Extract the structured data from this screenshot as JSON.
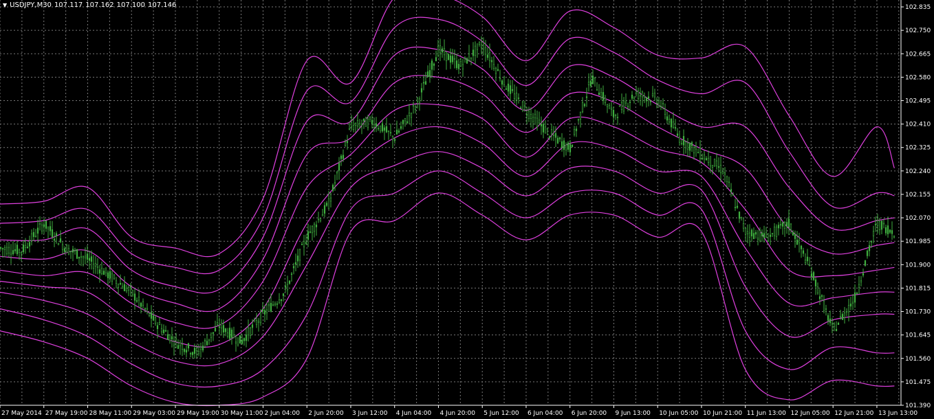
{
  "colors": {
    "background": "#000000",
    "grid": "#7a7a7a",
    "axis": "#ffffff",
    "candle": "#3fae3f",
    "bands": "#e040e0"
  },
  "header": {
    "collapse_icon": "triangle-down-icon",
    "symbol": "USDJPY,M30",
    "ohlc": [
      "107.117",
      "107.162",
      "107.100",
      "107.146"
    ]
  },
  "chart_data": {
    "type": "candlestick",
    "title": "USDJPY,M30",
    "grid": true,
    "price_axis": "right",
    "ylim": [
      101.39,
      102.86
    ],
    "y_ticks": [
      102.835,
      102.75,
      102.665,
      102.58,
      102.495,
      102.41,
      102.325,
      102.24,
      102.155,
      102.07,
      101.985,
      101.9,
      101.815,
      101.73,
      101.645,
      101.56,
      101.475,
      101.39
    ],
    "y_tick_labels": [
      "102.835",
      "102.750",
      "102.665",
      "102.580",
      "102.495",
      "102.410",
      "102.325",
      "102.240",
      "102.155",
      "102.070",
      "101.985",
      "101.900",
      "101.815",
      "101.730",
      "101.645",
      "101.560",
      "101.475",
      "101.390"
    ],
    "x_tick_labels": [
      "27 May 2014",
      "27 May 19:00",
      "28 May 11:00",
      "29 May 03:00",
      "29 May 19:00",
      "30 May 11:00",
      "2 Jun 04:00",
      "2 Jun 20:00",
      "3 Jun 12:00",
      "4 Jun 04:00",
      "4 Jun 20:00",
      "5 Jun 12:00",
      "6 Jun 04:00",
      "6 Jun 20:00",
      "9 Jun 13:00",
      "10 Jun 05:00",
      "10 Jun 21:00",
      "11 Jun 13:00",
      "12 Jun 05:00",
      "12 Jun 21:00",
      "13 Jun 13:00"
    ],
    "series": [
      {
        "kind": "price",
        "x": [
          0,
          0.5,
          1,
          1.5,
          2,
          2.5,
          3,
          3.5,
          4,
          4.5,
          5,
          5.5,
          6,
          6.5,
          7,
          7.5,
          8,
          8.5,
          9,
          9.5,
          10,
          10.5,
          11,
          11.5,
          12,
          12.5,
          13,
          13.5,
          14,
          14.5,
          15,
          15.5,
          16,
          16.5,
          17,
          17.5,
          18,
          18.5,
          19,
          19.5,
          20,
          20.4
        ],
        "values": [
          101.96,
          101.95,
          102.05,
          101.96,
          101.92,
          101.86,
          101.8,
          101.7,
          101.62,
          101.58,
          101.68,
          101.62,
          101.72,
          101.8,
          102.0,
          102.12,
          102.4,
          102.42,
          102.36,
          102.48,
          102.68,
          102.62,
          102.7,
          102.56,
          102.46,
          102.38,
          102.32,
          102.58,
          102.44,
          102.52,
          102.5,
          102.36,
          102.3,
          102.24,
          102.02,
          102.0,
          102.05,
          101.88,
          101.66,
          101.78,
          102.05,
          102.02
        ]
      },
      {
        "kind": "band",
        "x": [
          0,
          1,
          2,
          3,
          4,
          5,
          6,
          7,
          8,
          9,
          10,
          11,
          12,
          13,
          14,
          15,
          16,
          17,
          18,
          19,
          20,
          20.4
        ],
        "values": [
          102.12,
          102.13,
          102.18,
          102.0,
          101.96,
          101.94,
          102.14,
          102.64,
          102.56,
          102.87,
          102.88,
          102.8,
          102.64,
          102.82,
          102.76,
          102.66,
          102.65,
          102.69,
          102.44,
          102.22,
          102.4,
          102.25
        ]
      },
      {
        "kind": "band",
        "x": [
          0,
          1,
          2,
          3,
          4,
          5,
          6,
          7,
          8,
          9,
          10,
          11,
          12,
          13,
          14,
          15,
          16,
          17,
          18,
          19,
          20,
          20.4
        ],
        "values": [
          102.05,
          102.06,
          102.1,
          101.94,
          101.89,
          101.88,
          102.07,
          102.53,
          102.49,
          102.76,
          102.79,
          102.71,
          102.55,
          102.72,
          102.67,
          102.57,
          102.52,
          102.56,
          102.31,
          102.11,
          102.16,
          102.15
        ]
      },
      {
        "kind": "band",
        "x": [
          0,
          1,
          2,
          3,
          4,
          5,
          6,
          7,
          8,
          9,
          10,
          11,
          12,
          13,
          14,
          15,
          16,
          17,
          18,
          19,
          20,
          20.4
        ],
        "values": [
          101.99,
          101.99,
          102.03,
          101.88,
          101.82,
          101.81,
          102.0,
          102.42,
          102.42,
          102.66,
          102.68,
          102.61,
          102.46,
          102.62,
          102.58,
          102.48,
          102.4,
          102.4,
          102.18,
          102.03,
          102.06,
          102.07
        ]
      },
      {
        "kind": "band",
        "x": [
          0,
          1,
          2,
          3,
          4,
          5,
          6,
          7,
          8,
          9,
          10,
          11,
          12,
          13,
          14,
          15,
          16,
          17,
          18,
          19,
          20,
          20.4
        ],
        "values": [
          101.93,
          101.92,
          101.95,
          101.82,
          101.76,
          101.74,
          101.92,
          102.3,
          102.36,
          102.56,
          102.58,
          102.52,
          102.38,
          102.52,
          102.49,
          102.4,
          102.32,
          102.25,
          102.03,
          101.94,
          101.97,
          101.98
        ]
      },
      {
        "kind": "band",
        "x": [
          0,
          1,
          2,
          3,
          4,
          5,
          6,
          7,
          8,
          9,
          10,
          11,
          12,
          13,
          14,
          15,
          16,
          17,
          18,
          19,
          20,
          20.4
        ],
        "values": [
          101.88,
          101.86,
          101.87,
          101.76,
          101.69,
          101.68,
          101.84,
          102.18,
          102.3,
          102.46,
          102.48,
          102.43,
          102.29,
          102.43,
          102.4,
          102.32,
          102.27,
          102.1,
          101.88,
          101.86,
          101.88,
          101.89
        ]
      },
      {
        "kind": "band",
        "x": [
          0,
          1,
          2,
          3,
          4,
          5,
          6,
          7,
          8,
          9,
          10,
          11,
          12,
          13,
          14,
          15,
          16,
          17,
          18,
          19,
          20,
          20.4
        ],
        "values": [
          101.84,
          101.82,
          101.8,
          101.69,
          101.62,
          101.61,
          101.74,
          102.05,
          102.24,
          102.36,
          102.4,
          102.34,
          102.22,
          102.34,
          102.32,
          102.24,
          102.22,
          101.96,
          101.76,
          101.78,
          101.8,
          101.8
        ]
      },
      {
        "kind": "band",
        "x": [
          0,
          1,
          2,
          3,
          4,
          5,
          6,
          7,
          8,
          9,
          10,
          11,
          12,
          13,
          14,
          15,
          16,
          17,
          18,
          19,
          20,
          20.4
        ],
        "values": [
          101.8,
          101.77,
          101.72,
          101.62,
          101.55,
          101.54,
          101.64,
          101.9,
          102.18,
          102.26,
          102.31,
          102.25,
          102.15,
          102.25,
          102.24,
          102.16,
          102.17,
          101.82,
          101.64,
          101.7,
          101.72,
          101.72
        ]
      },
      {
        "kind": "band",
        "x": [
          0,
          1,
          2,
          3,
          4,
          5,
          6,
          7,
          8,
          9,
          10,
          11,
          12,
          13,
          14,
          15,
          16,
          17,
          18,
          19,
          20,
          20.4
        ],
        "values": [
          101.74,
          101.7,
          101.64,
          101.54,
          101.47,
          101.46,
          101.52,
          101.72,
          102.1,
          102.16,
          102.24,
          102.16,
          102.07,
          102.16,
          102.16,
          102.08,
          102.1,
          101.66,
          101.52,
          101.6,
          101.58,
          101.58
        ]
      },
      {
        "kind": "band",
        "x": [
          0,
          1,
          2,
          3,
          4,
          5,
          6,
          7,
          8,
          9,
          10,
          11,
          12,
          13,
          14,
          15,
          16,
          17,
          18,
          19,
          20,
          20.4
        ],
        "values": [
          101.66,
          101.62,
          101.56,
          101.46,
          101.4,
          101.39,
          101.42,
          101.56,
          102.02,
          102.06,
          102.16,
          102.08,
          101.99,
          102.08,
          102.08,
          102.0,
          102.02,
          101.52,
          101.41,
          101.48,
          101.46,
          101.46
        ]
      }
    ]
  }
}
